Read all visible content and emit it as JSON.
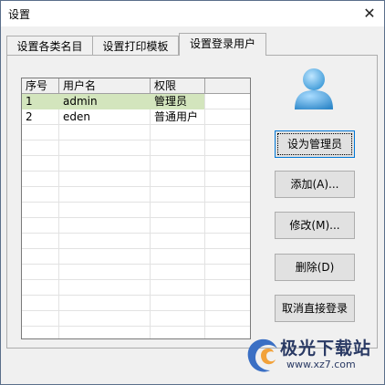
{
  "window": {
    "title": "设置",
    "close_glyph": "✕"
  },
  "tabs": [
    {
      "label": "设置各类名目",
      "active": false
    },
    {
      "label": "设置打印模板",
      "active": false
    },
    {
      "label": "设置登录用户",
      "active": true
    }
  ],
  "grid": {
    "columns": [
      "序号",
      "用户名",
      "权限"
    ],
    "rows": [
      {
        "no": "1",
        "user": "admin",
        "role": "管理员",
        "selected": true
      },
      {
        "no": "2",
        "user": "eden",
        "role": "普通用户",
        "selected": false
      }
    ]
  },
  "buttons": {
    "set_admin": "设为管理员",
    "add": "添加(A)...",
    "modify": "修改(M)...",
    "delete": "删除(D)",
    "cancel_direct_login": "取消直接登录"
  },
  "watermark": {
    "name": "极光下载站",
    "url": "www.xz7.com"
  },
  "colors": {
    "selected_row": "#d3e5bd",
    "avatar": "#5ab0e6",
    "focus_border": "#0078d7"
  },
  "icons": {
    "user_avatar": "user-icon",
    "close": "close-icon"
  }
}
